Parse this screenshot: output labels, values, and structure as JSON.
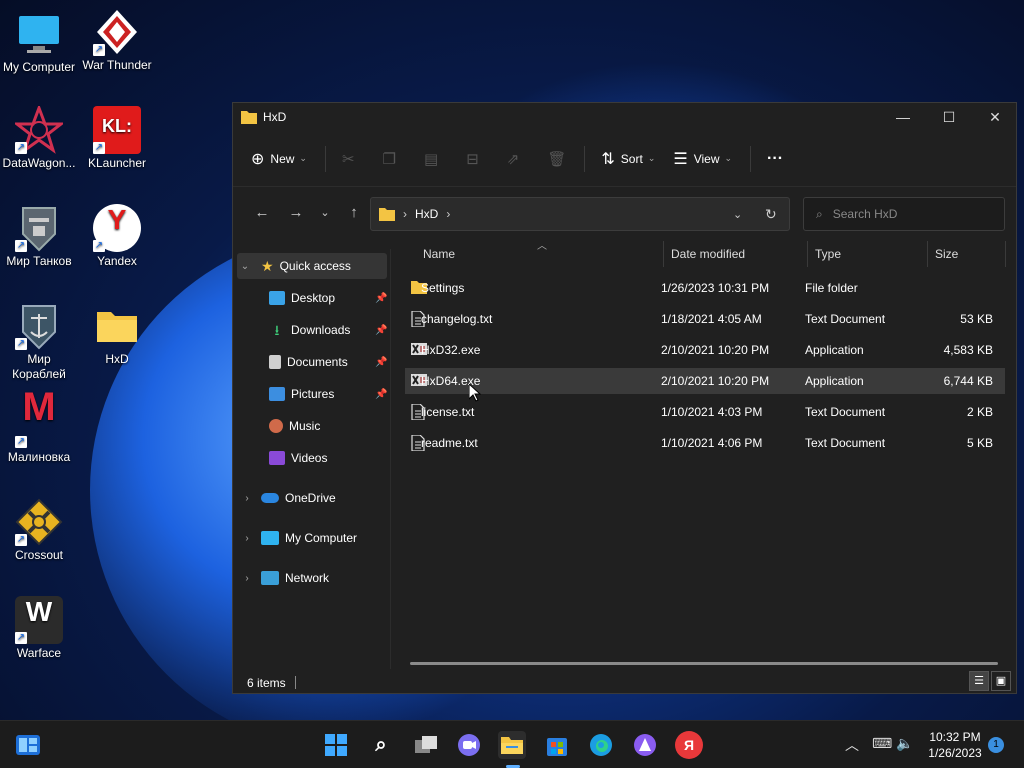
{
  "desktop": {
    "icons": [
      {
        "label": "My Computer",
        "icon": "monitor-icon"
      },
      {
        "label": "War Thunder",
        "icon": "war-thunder-icon"
      },
      {
        "label": "DataWagon...",
        "icon": "datawagon-icon"
      },
      {
        "label": "KLauncher",
        "icon": "klauncher-icon",
        "badge": "KL:"
      },
      {
        "label": "Мир Танков",
        "icon": "tanks-icon"
      },
      {
        "label": "Yandex",
        "icon": "yandex-icon",
        "badge": "Y"
      },
      {
        "label": "Мир Кораблей",
        "icon": "ships-icon"
      },
      {
        "label": "HxD",
        "icon": "folder-icon"
      },
      {
        "label": "Малиновка",
        "icon": "malinovka-icon",
        "badge": "M"
      },
      {
        "label": "Crossout",
        "icon": "crossout-icon"
      },
      {
        "label": "Warface",
        "icon": "warface-icon",
        "badge": "W"
      }
    ]
  },
  "window": {
    "title": "HxD",
    "controls": {
      "minimize": "—",
      "maximize": "☐",
      "close": "✕"
    }
  },
  "toolbar": {
    "new_label": "New",
    "sort_label": "Sort",
    "view_label": "View",
    "more_label": "···"
  },
  "address": {
    "path": [
      "HxD"
    ],
    "search_placeholder": "Search HxD"
  },
  "nav": {
    "quick_access": "Quick access",
    "items": [
      {
        "label": "Desktop",
        "pinned": true
      },
      {
        "label": "Downloads",
        "pinned": true
      },
      {
        "label": "Documents",
        "pinned": true
      },
      {
        "label": "Pictures",
        "pinned": true
      },
      {
        "label": "Music",
        "pinned": false
      },
      {
        "label": "Videos",
        "pinned": false
      }
    ],
    "onedrive": "OneDrive",
    "my_computer": "My Computer",
    "network": "Network"
  },
  "columns": {
    "name": "Name",
    "date": "Date modified",
    "type": "Type",
    "size": "Size"
  },
  "files": [
    {
      "name": "Settings",
      "date": "1/26/2023 10:31 PM",
      "type": "File folder",
      "size": "",
      "icon": "folder-icon"
    },
    {
      "name": "changelog.txt",
      "date": "1/18/2021 4:05 AM",
      "type": "Text Document",
      "size": "53 KB",
      "icon": "text-file-icon"
    },
    {
      "name": "HxD32.exe",
      "date": "2/10/2021 10:20 PM",
      "type": "Application",
      "size": "4,583 KB",
      "icon": "hxd-app-icon"
    },
    {
      "name": "HxD64.exe",
      "date": "2/10/2021 10:20 PM",
      "type": "Application",
      "size": "6,744 KB",
      "icon": "hxd-app-icon",
      "selected": true
    },
    {
      "name": "license.txt",
      "date": "1/10/2021 4:03 PM",
      "type": "Text Document",
      "size": "2 KB",
      "icon": "text-file-icon"
    },
    {
      "name": "readme.txt",
      "date": "1/10/2021 4:06 PM",
      "type": "Text Document",
      "size": "5 KB",
      "icon": "text-file-icon"
    }
  ],
  "status": {
    "count": "6 items"
  },
  "taskbar": {
    "time": "10:32 PM",
    "date": "1/26/2023",
    "notifications": "1",
    "pinned_yandex": "Я"
  },
  "colors": {
    "accent": "#3a8fe0",
    "folder": "#f3c443",
    "selection": "#3a3a3a",
    "window_bg": "#202020"
  }
}
